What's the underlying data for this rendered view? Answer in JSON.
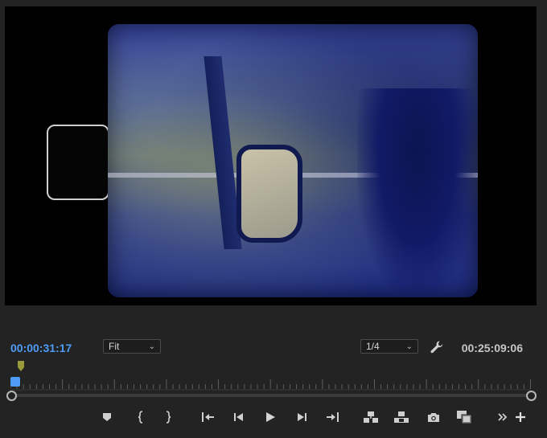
{
  "monitor": {
    "current_timecode": "00:00:31:17",
    "duration_timecode": "00:25:09:06",
    "zoom_select": {
      "value": "Fit"
    },
    "resolution_select": {
      "value": "1/4"
    }
  },
  "timeline": {
    "progress_fraction": 0.02
  },
  "controls": [
    {
      "name": "add-marker-button",
      "icon": "marker-icon"
    },
    {
      "name": "mark-in-button",
      "icon": "mark-in-icon"
    },
    {
      "name": "mark-out-button",
      "icon": "mark-out-icon"
    },
    {
      "name": "go-to-in-button",
      "icon": "go-to-in-icon"
    },
    {
      "name": "step-back-button",
      "icon": "step-back-icon"
    },
    {
      "name": "play-button",
      "icon": "play-icon"
    },
    {
      "name": "step-forward-button",
      "icon": "step-forward-icon"
    },
    {
      "name": "go-to-out-button",
      "icon": "go-to-out-icon"
    },
    {
      "name": "insert-button",
      "icon": "insert-icon"
    },
    {
      "name": "overwrite-button",
      "icon": "overwrite-icon"
    },
    {
      "name": "export-frame-button",
      "icon": "camera-icon"
    },
    {
      "name": "comparison-view-button",
      "icon": "comparison-icon"
    },
    {
      "name": "more-controls-button",
      "icon": "double-chevron-right-icon"
    },
    {
      "name": "button-editor-button",
      "icon": "plus-icon"
    }
  ],
  "colors": {
    "accent": "#4e9cf5",
    "panel": "#232323",
    "playhead_flag": "#9a9a3a"
  }
}
